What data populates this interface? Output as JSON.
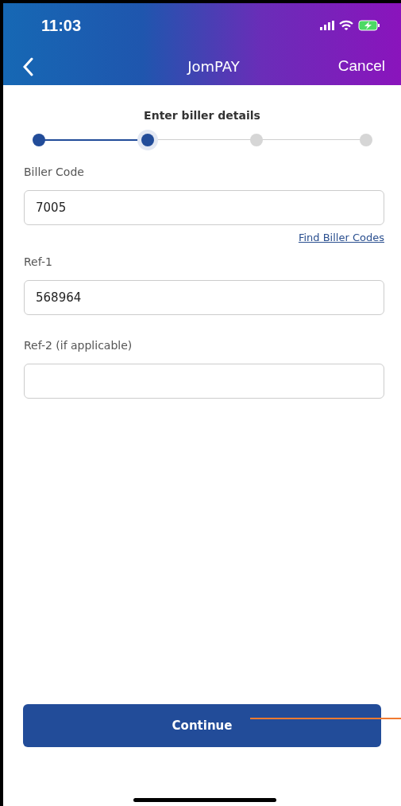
{
  "status_bar": {
    "time": "11:03"
  },
  "nav": {
    "title": "JomPAY",
    "action": "Cancel"
  },
  "stepper": {
    "label": "Enter biller details",
    "steps": [
      {
        "kind": "done"
      },
      {
        "kind": "current"
      },
      {
        "kind": "pending"
      },
      {
        "kind": "pending"
      }
    ]
  },
  "fields": [
    {
      "label": "Biller Code",
      "value": "7005",
      "link": "Find Biller Codes"
    },
    {
      "label": "Ref-1",
      "value": "568964"
    },
    {
      "label": "Ref-2 (if applicable)"
    }
  ],
  "button": "Continue"
}
